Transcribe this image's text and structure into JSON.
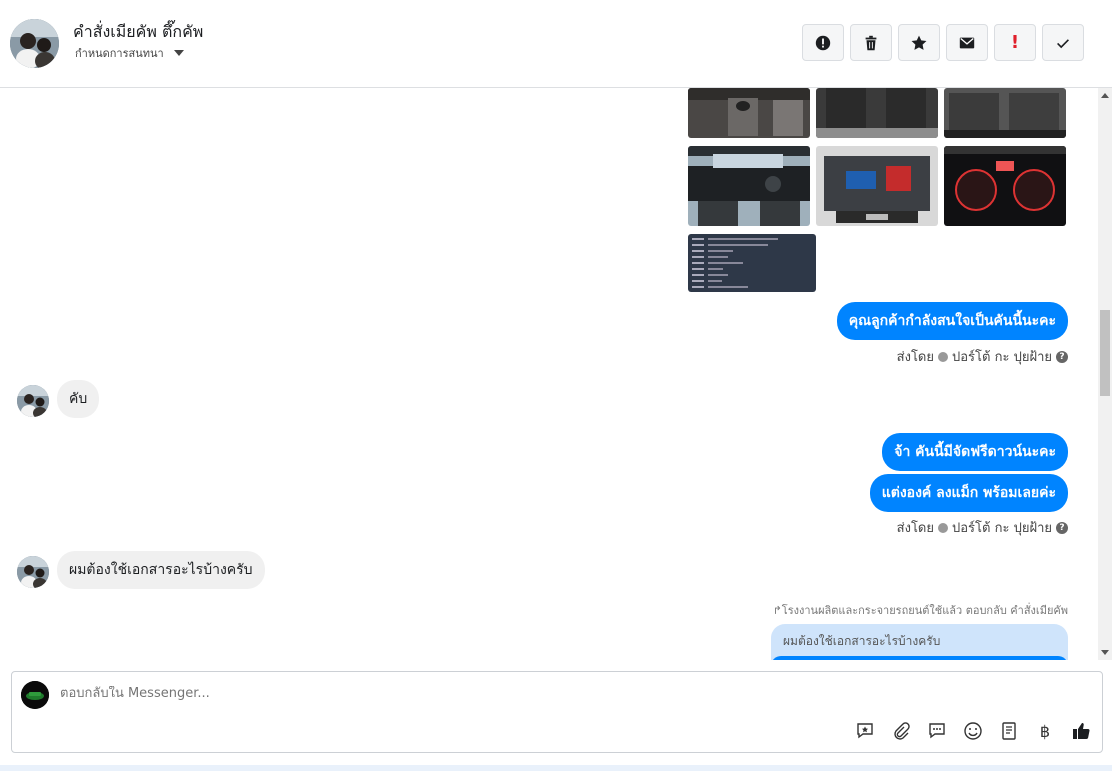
{
  "header": {
    "contact_name": "คำสั่งเมียคัพ ตึ๊กคัพ",
    "subtitle": "กำหนดการสนทนา"
  },
  "toolbar": {
    "buttons": [
      "spam-icon",
      "trash-icon",
      "star-icon",
      "envelope-icon",
      "important-icon",
      "check-icon"
    ],
    "important_glyph": "!"
  },
  "messages": {
    "out_1": "คุณลูกค้ากำลังสนใจเป็นคันนี้นะคะ",
    "sent_by_1": "ส่งโดย",
    "sender_1": "ปอร์โต้ กะ ปุยฝ้าย",
    "in_1": "คับ",
    "out_2": "จ้า คันนี้มีจัดฟรีดาวน์นะคะ",
    "out_3": "แต่งองค์ ลงแม็ก พร้อมเลยค่ะ",
    "sent_by_2": "ส่งโดย",
    "sender_2": "ปอร์โต้ กะ ปุยฝ้าย",
    "in_2": "ผมต้องใช้เอกสารอะไรบ้างครับ",
    "reply_note": "↱โรงงานผลิตและกระจายรถยนต์ใช้แล้ว ตอบกลับ คำสั่งเมียคัพ",
    "quoted_text": "ผมต้องใช้เอกสารอะไรบ้างครับ",
    "help_glyph": "?"
  },
  "composer": {
    "placeholder": "ตอบกลับใน Messenger...",
    "icons": [
      "emoji-reply-icon",
      "attachment-icon",
      "saved-reply-icon",
      "emoji-icon",
      "book-icon",
      "payment-icon",
      "like-icon"
    ],
    "currency_glyph": "฿"
  }
}
